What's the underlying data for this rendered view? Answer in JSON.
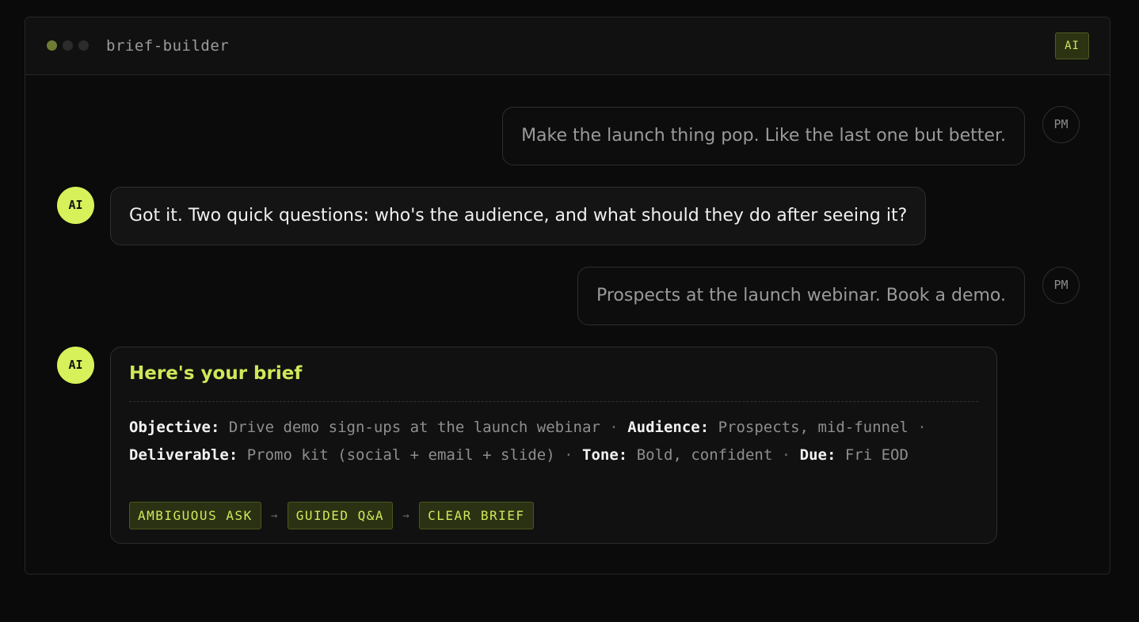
{
  "window": {
    "title": "brief-builder",
    "badge": "AI"
  },
  "messages": [
    {
      "role": "user",
      "avatar": "PM",
      "text": "Make the launch thing pop. Like the last one but better."
    },
    {
      "role": "ai",
      "avatar": "AI",
      "text": "Got it. Two quick questions: who's the audience, and what should they do after seeing it?"
    },
    {
      "role": "user",
      "avatar": "PM",
      "text": "Prospects at the launch webinar. Book a demo."
    }
  ],
  "brief": {
    "avatar": "AI",
    "title": "Here's your brief",
    "fields": [
      {
        "label": "Objective:",
        "value": "Drive demo sign-ups at the launch webinar"
      },
      {
        "label": "Audience:",
        "value": "Prospects, mid-funnel"
      },
      {
        "label": "Deliverable:",
        "value": "Promo kit (social + email + slide)"
      },
      {
        "label": "Tone:",
        "value": "Bold, confident"
      },
      {
        "label": "Due:",
        "value": "Fri EOD"
      }
    ],
    "separator": "·",
    "flow": [
      "AMBIGUOUS ASK",
      "GUIDED Q&A",
      "CLEAR BRIEF"
    ],
    "flow_arrow": "→"
  },
  "colors": {
    "accent": "#d6f15a",
    "background": "#0a0a0a",
    "tag_background": "#2b3213"
  }
}
